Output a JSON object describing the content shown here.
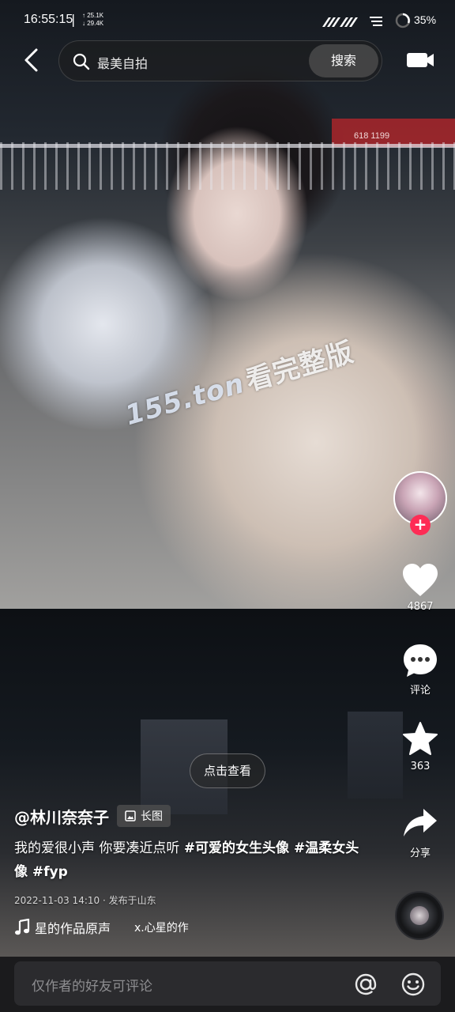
{
  "status_bar": {
    "time": "16:55:15",
    "separator": "|",
    "net_up": "25.1K",
    "net_down": "29.4K",
    "battery": "35%"
  },
  "search": {
    "placeholder": "最美自拍",
    "button_label": "搜索"
  },
  "watermark": {
    "number": "155.ton",
    "text": "看完整版"
  },
  "sign_text": "618 1199",
  "sidebar": {
    "likes": "4867",
    "comments_label": "评论",
    "favorites": "363",
    "share_label": "分享",
    "follow_symbol": "+"
  },
  "post": {
    "view_button": "点击查看",
    "author": "@林川奈奈子",
    "badge": "长图",
    "caption_text": "我的爱很小声 你要凑近点听 ",
    "tag1": "#可爱的女生头像",
    "tag2": " #温柔女头像",
    "tag3": " #fyp",
    "meta": "2022-11-03 14:10 · 发布于山东",
    "music_title": "星的作品原声",
    "music_author": "x.心星的作"
  },
  "comment_bar": {
    "placeholder": "仅作者的好友可评论"
  },
  "icons": {
    "back": "chevron-left-icon",
    "search": "search-icon",
    "camera": "camera-icon",
    "like": "heart-icon",
    "comment": "comment-icon",
    "favorite": "star-icon",
    "share": "share-arrow-icon",
    "music": "music-note-icon",
    "image": "image-icon",
    "at": "at-icon",
    "emoji": "emoji-icon"
  },
  "colors": {
    "follow_red": "#fe2c55",
    "comment_bar_bg": "#1b1b1d"
  }
}
